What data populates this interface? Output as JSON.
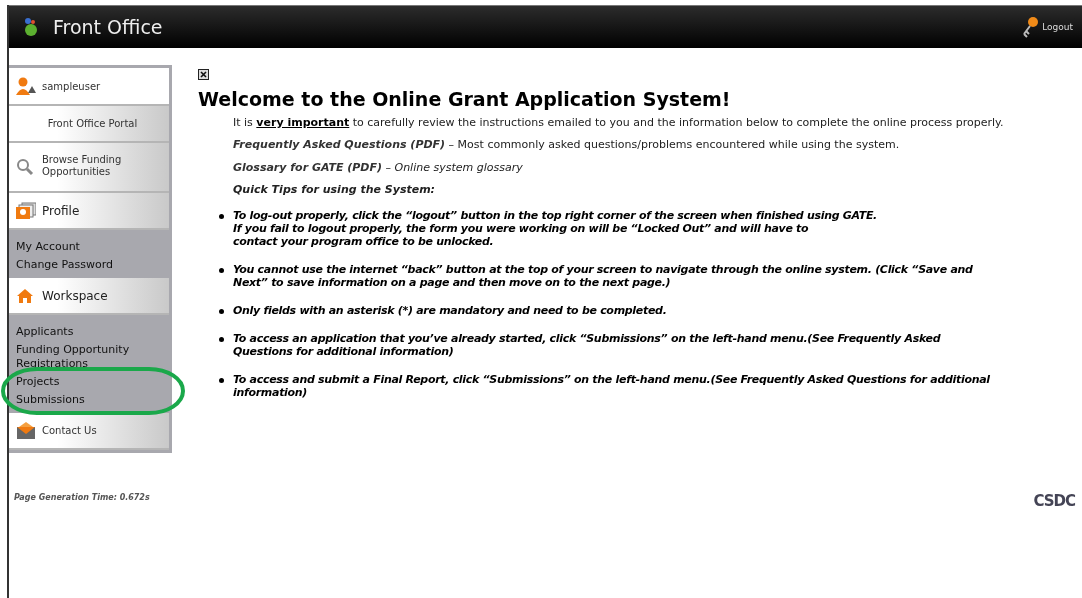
{
  "header": {
    "title": "Front Office",
    "logout": "Logout"
  },
  "sidebar": {
    "user": "sampleuser",
    "sections": [
      {
        "kind": "button",
        "label": "Front Office Portal"
      },
      {
        "kind": "button",
        "label": "Browse Funding Opportunities"
      },
      {
        "kind": "button",
        "label": "Profile"
      },
      {
        "kind": "links",
        "items": [
          "My Account",
          "Change Password"
        ]
      },
      {
        "kind": "button",
        "label": "Workspace"
      },
      {
        "kind": "links",
        "items": [
          "Applicants",
          "Funding Opportunity Registrations",
          "Projects",
          "Submissions"
        ]
      },
      {
        "kind": "button",
        "label": "Contact Us"
      }
    ]
  },
  "annotation": {
    "kind": "ellipse",
    "color": "#1aa84a"
  },
  "content": {
    "heading": "Welcome to the Online Grant Application System!",
    "intro": "It is **very important** to carefully review the instructions emailed to you and the information below to complete the online process properly.",
    "links": [
      {
        "link": "Frequently Asked Questions (PDF)",
        "text": " – Most commonly asked questions/problems encountered while using the system.",
        "italic": false
      },
      {
        "link": "Glossary for GATE (PDF)",
        "text": " – Online system glossary",
        "italic": true
      }
    ],
    "tips_heading": "Quick Tips for using the System:",
    "tips": [
      {
        "lines": [
          "To log-out properly, click the “logout” button in the top right corner of the screen when finished using GATE.",
          "If you fail to logout properly, the form you were working on will be “Locked Out” and will have to",
          "contact your program office to be unlocked."
        ]
      },
      {
        "lines": [
          "You cannot use the internet “back” button at the top of your screen to navigate through the online system. (Click “Save and",
          "Next” to save information on a page and then move on to the next page.)"
        ]
      },
      {
        "lines": [
          "Only fields with an asterisk (*) are mandatory and need to be completed."
        ]
      },
      {
        "lines": [
          "To access an application that you’ve already started, click “Submissions” on the left-hand menu.(See Frequently Asked",
          "Questions for additional information)"
        ]
      },
      {
        "lines": [
          "To access and submit a Final Report, click “Submissions” on the left-hand menu.(See Frequently Asked Questions for additional",
          "information)"
        ]
      }
    ]
  },
  "footer": {
    "generation_time": "Page Generation Time: 0.672s",
    "logo": "CSDC"
  }
}
